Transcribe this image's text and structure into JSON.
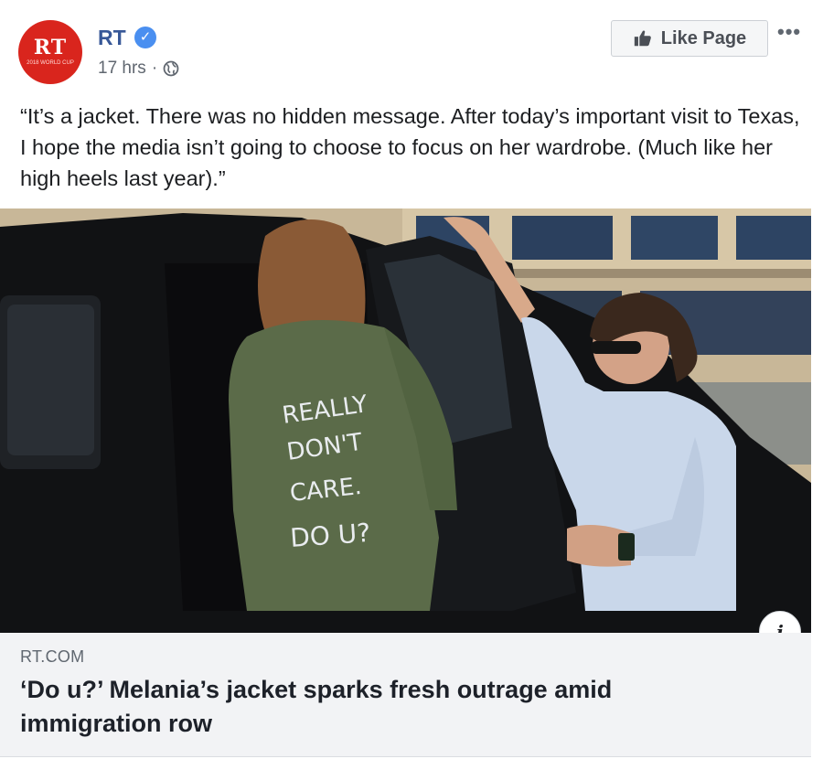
{
  "header": {
    "page_name": "RT",
    "avatar_text": "RT",
    "avatar_subtext": "2018 WORLD CUP",
    "timestamp": "17 hrs",
    "separator": "·",
    "privacy_icon": "globe-icon",
    "verified_icon": "verified-badge-icon"
  },
  "actions": {
    "like_page_label": "Like Page",
    "like_icon": "thumbs-up-icon",
    "more_label": "•••"
  },
  "post": {
    "text": "“It’s a jacket. There was no hidden message. After today’s important visit to Texas, I hope the media isn’t going to choose to focus on her wardrobe. (Much like her high heels last year).”"
  },
  "image": {
    "jacket_text": "REALLY DON'T CARE. DO U?",
    "info_label": "i"
  },
  "link_preview": {
    "domain": "RT.COM",
    "title": "‘Do u?’ Melania’s jacket sparks fresh outrage amid immigration row"
  },
  "colors": {
    "brand_red": "#d9251d",
    "link_blue": "#385898",
    "verified_blue": "#4a8ff0",
    "preview_bg": "#f2f3f5"
  }
}
